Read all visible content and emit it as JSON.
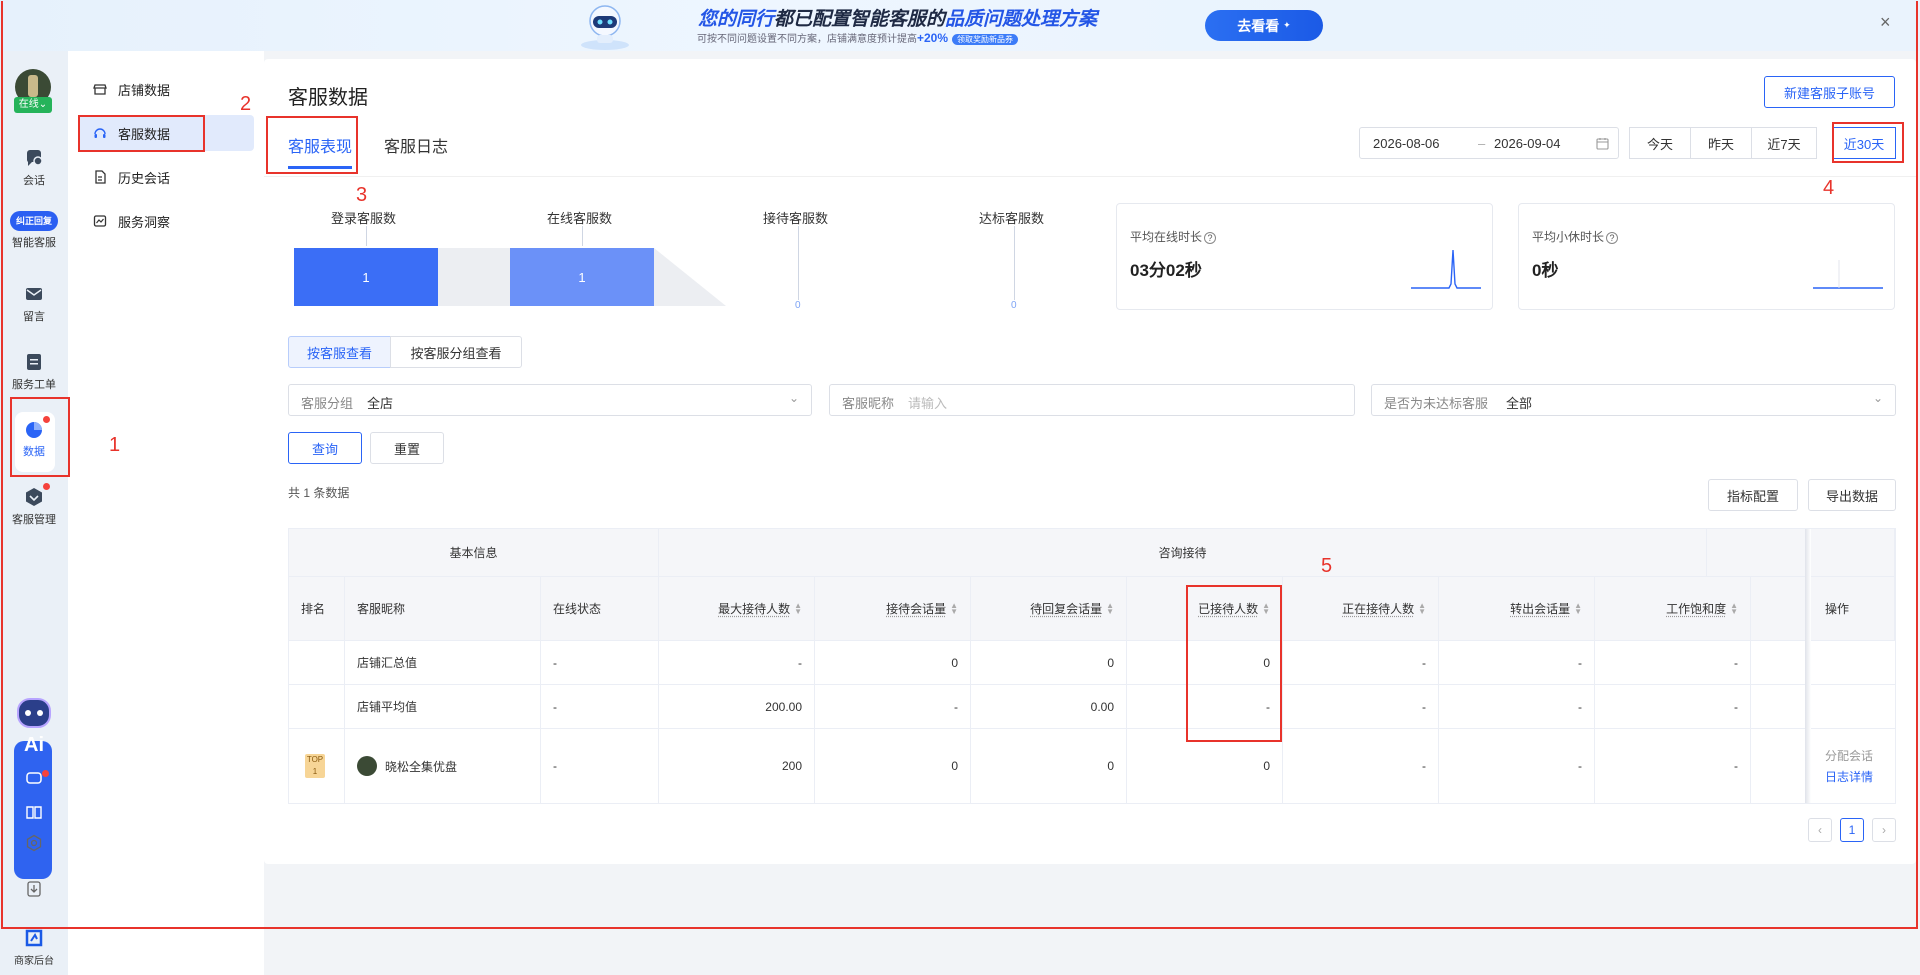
{
  "banner": {
    "headline_hl1": "您的同行",
    "headline_mid": "都已配置智能客服的",
    "headline_hl2": "品质问题处理方案",
    "sub_prefix": "可按不同问题设置不同方案，店铺满意度预计提高",
    "sub_pct": "+20%",
    "sub_chip": "领取奖励新品券",
    "cta": "去看看",
    "close": "×"
  },
  "rail": {
    "status": "在线",
    "items": [
      {
        "label": "会话",
        "icon": "chat-icon"
      },
      {
        "label": "智能客服",
        "icon": "ai-service-icon",
        "badge": "纠正回复"
      },
      {
        "label": "留言",
        "icon": "message-icon"
      },
      {
        "label": "服务工单",
        "icon": "ticket-icon"
      },
      {
        "label": "数据",
        "icon": "pie-chart-icon"
      },
      {
        "label": "客服管理",
        "icon": "agent-manage-icon"
      }
    ],
    "ai_label": "Ai",
    "bottom_label": "商家后台"
  },
  "subnav": {
    "items": [
      {
        "label": "店铺数据",
        "icon": "store-icon"
      },
      {
        "label": "客服数据",
        "icon": "headset-icon"
      },
      {
        "label": "历史会话",
        "icon": "history-doc-icon"
      },
      {
        "label": "服务洞察",
        "icon": "insight-icon"
      }
    ]
  },
  "page": {
    "title": "客服数据",
    "new_account": "新建客服子账号",
    "tabs": [
      "客服表现",
      "客服日志"
    ],
    "date_start": "2026-08-06",
    "date_sep": "–",
    "date_end": "2026-09-04",
    "quick_dates": [
      "今天",
      "昨天",
      "近7天",
      "近30天"
    ]
  },
  "funnel": {
    "labels": [
      "登录客服数",
      "在线客服数",
      "接待客服数",
      "达标客服数"
    ],
    "values": [
      "1",
      "1",
      "0",
      "0"
    ]
  },
  "stats": [
    {
      "label": "平均在线时长",
      "value": "03分02秒",
      "info": "?"
    },
    {
      "label": "平均小休时长",
      "value": "0秒",
      "info": "?"
    }
  ],
  "view_toggle": [
    "按客服查看",
    "按客服分组查看"
  ],
  "filters": {
    "group_label": "客服分组",
    "group_value": "全店",
    "nick_label": "客服昵称",
    "nick_placeholder": "请输入",
    "substandard_label": "是否为未达标客服",
    "substandard_value": "全部"
  },
  "actions": {
    "query": "查询",
    "reset": "重置",
    "metric_config": "指标配置",
    "export": "导出数据"
  },
  "count_text": "共 1 条数据",
  "table": {
    "groups": [
      "基本信息",
      "咨询接待"
    ],
    "columns": [
      "排名",
      "客服昵称",
      "在线状态",
      "最大接待人数",
      "接待会话量",
      "待回复会话量",
      "已接待人数",
      "正在接待人数",
      "转出会话量",
      "工作饱和度",
      "操作"
    ],
    "rows": [
      {
        "rank": "",
        "name": "店铺汇总值",
        "status": "-",
        "max": "-",
        "sessions": "0",
        "pending": "0",
        "received": "0",
        "receiving": "-",
        "transfer": "-",
        "saturation": "-"
      },
      {
        "rank": "",
        "name": "店铺平均值",
        "status": "-",
        "max": "200.00",
        "sessions": "-",
        "pending": "0.00",
        "received": "-",
        "receiving": "-",
        "transfer": "-",
        "saturation": "-"
      },
      {
        "rank": "TOP 1",
        "name": "晓松全集优盘",
        "status": "-",
        "max": "200",
        "sessions": "0",
        "pending": "0",
        "received": "0",
        "receiving": "-",
        "transfer": "-",
        "saturation": "-",
        "op1": "分配会话",
        "op2": "日志详情"
      }
    ]
  },
  "pagination": {
    "prev": "‹",
    "current": "1",
    "next": "›"
  },
  "annotations": [
    "1",
    "2",
    "3",
    "4",
    "5"
  ],
  "colors": {
    "accent": "#2a64f6",
    "annotation": "#e8332b",
    "online": "#25b35a"
  }
}
